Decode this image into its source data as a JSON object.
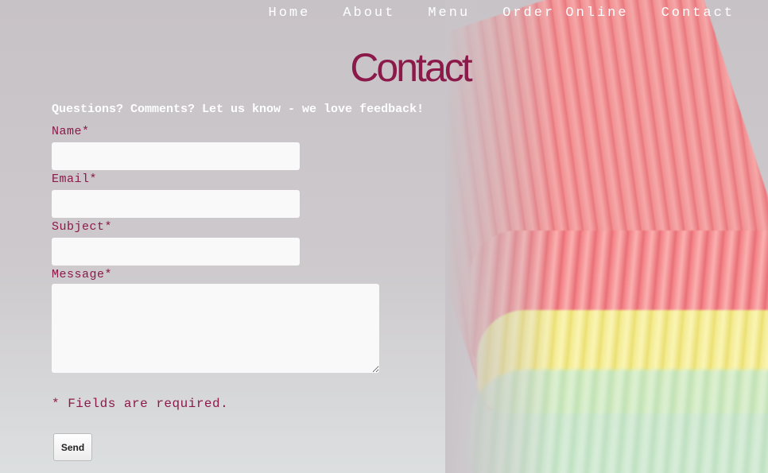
{
  "nav": {
    "items": [
      {
        "label": "Home"
      },
      {
        "label": "About"
      },
      {
        "label": "Menu"
      },
      {
        "label": "Order Online"
      },
      {
        "label": "Contact"
      }
    ]
  },
  "page": {
    "title": "Contact",
    "intro": "Questions? Comments? Let us know - we love feedback!"
  },
  "form": {
    "name_label": "Name*",
    "name_value": "",
    "email_label": "Email*",
    "email_value": "",
    "subject_label": "Subject*",
    "subject_value": "",
    "message_label": "Message*",
    "message_value": "",
    "required_note": "* Fields are required.",
    "send_label": "Send"
  },
  "colors": {
    "accent": "#8b1a4a",
    "nav_text": "#ffffff",
    "input_bg": "#f9f9f9"
  }
}
